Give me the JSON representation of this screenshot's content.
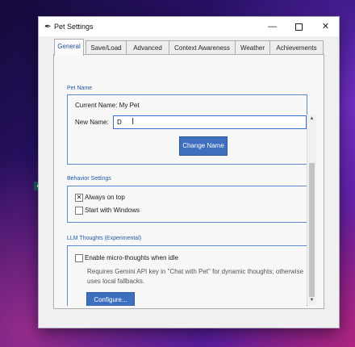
{
  "window": {
    "title": "Pet Settings",
    "minimize": "—",
    "close": "✕"
  },
  "tabs": [
    {
      "label": "General",
      "active": true
    },
    {
      "label": "Save/Load"
    },
    {
      "label": "Advanced"
    },
    {
      "label": "Context Awareness"
    },
    {
      "label": "Weather"
    },
    {
      "label": "Achievements"
    }
  ],
  "pet_name": {
    "section": "Pet Name",
    "current_name": "Current Name: My Pet",
    "new_name_label": "New Name:",
    "new_name_value": "D",
    "change_button": "Change Name"
  },
  "behavior": {
    "section": "Behavior Settings",
    "always_on_top": {
      "label": "Always on top",
      "checked": true,
      "mark": "✕"
    },
    "start_with_windows": {
      "label": "Start with Windows",
      "checked": false
    }
  },
  "llm": {
    "section": "LLM Thoughts (Experimental)",
    "enable_label": "Enable micro-thoughts when idle",
    "description": "Requires Gemini API key in \"Chat with Pet\" for dynamic thoughts; otherwise uses local fallbacks.",
    "configure_button": "Configure..."
  },
  "scrollbar": {
    "up": "▲",
    "down": "▼"
  }
}
